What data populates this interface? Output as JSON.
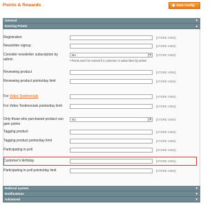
{
  "header": {
    "title": "Points & Rewards",
    "save_label": "Save Config"
  },
  "bars": {
    "general": "General",
    "earning": "Earning Points",
    "referral": "Referral system",
    "notifications": "Notifications",
    "advanced": "Advanced"
  },
  "scope_label": "[STORE VIEW]",
  "fields": [
    {
      "label": "Registration"
    },
    {
      "label": "Newsletter signup"
    },
    {
      "label": "Consider newsletter subscription by admin",
      "value": "No"
    },
    {
      "label": "Reviewing product"
    },
    {
      "label": "Reviewing product points/day limit"
    },
    {
      "label_prefix": "For ",
      "label_link": "Video Testimonials"
    },
    {
      "label": "For Video Testimonials points/day limit"
    },
    {
      "label": "Only those who purchased product can gain points",
      "value": "No"
    },
    {
      "label": "Tagging product"
    },
    {
      "label": "Tagging product points/day limit"
    },
    {
      "label": "Participating in poll"
    },
    {
      "label": "Customer's birthday"
    },
    {
      "label": "Participating in poll points/day limit"
    }
  ],
  "note": "Points won't be earned if a customer is subscribed by admin"
}
